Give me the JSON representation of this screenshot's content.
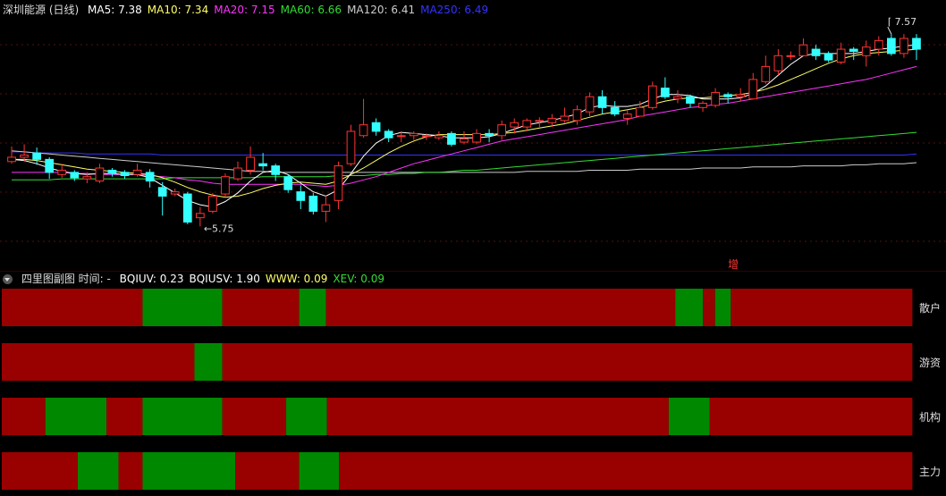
{
  "header": {
    "title": "深圳能源 (日线)",
    "ma_items": [
      {
        "label": "MA5: 7.38",
        "color": "#ffffff"
      },
      {
        "label": "MA10: 7.34",
        "color": "#ffff66"
      },
      {
        "label": "MA20: 7.15",
        "color": "#ff33ff"
      },
      {
        "label": "MA60: 6.66",
        "color": "#33dd33"
      },
      {
        "label": "MA120: 6.41",
        "color": "#cccccc"
      },
      {
        "label": "MA250: 6.49",
        "color": "#3333ff"
      }
    ]
  },
  "subheader": {
    "title": "四里图副图 时间: -",
    "items": [
      {
        "label": "BQIUV: 0.23",
        "color": "#ffffff"
      },
      {
        "label": "BQIUSV: 1.90",
        "color": "#ffffff"
      },
      {
        "label": "WWW: 0.09",
        "color": "#ffff66"
      },
      {
        "label": "XEV: 0.09",
        "color": "#33dd33"
      }
    ]
  },
  "colors": {
    "up": "#ff3333",
    "down": "#33ffff",
    "bar_red": "#990000",
    "bar_green": "#008800"
  },
  "chart_data": [
    {
      "type": "candlestick",
      "ylim": [
        5.5,
        7.75
      ],
      "annotations": {
        "high_label": "7.57",
        "low_label": "5.75",
        "marker": "增"
      },
      "candles": [
        [
          6.42,
          6.46,
          6.56,
          6.4
        ],
        [
          6.46,
          6.48,
          6.58,
          6.42
        ],
        [
          6.5,
          6.44,
          6.55,
          6.39
        ],
        [
          6.44,
          6.32,
          6.46,
          6.26
        ],
        [
          6.3,
          6.34,
          6.4,
          6.27
        ],
        [
          6.32,
          6.27,
          6.34,
          6.24
        ],
        [
          6.26,
          6.28,
          6.32,
          6.22
        ],
        [
          6.24,
          6.36,
          6.4,
          6.22
        ],
        [
          6.34,
          6.31,
          6.36,
          6.28
        ],
        [
          6.32,
          6.29,
          6.34,
          6.26
        ],
        [
          6.3,
          6.34,
          6.4,
          6.28
        ],
        [
          6.32,
          6.24,
          6.35,
          6.18
        ],
        [
          6.18,
          6.1,
          6.23,
          5.92
        ],
        [
          6.12,
          6.14,
          6.17,
          6.1
        ],
        [
          6.12,
          5.86,
          6.14,
          5.84
        ],
        [
          5.9,
          5.94,
          6.0,
          5.82
        ],
        [
          5.96,
          6.1,
          6.13,
          5.94
        ],
        [
          6.12,
          6.28,
          6.31,
          6.09
        ],
        [
          6.26,
          6.36,
          6.42,
          6.24
        ],
        [
          6.34,
          6.46,
          6.56,
          6.3
        ],
        [
          6.4,
          6.38,
          6.5,
          6.34
        ],
        [
          6.38,
          6.3,
          6.4,
          6.24
        ],
        [
          6.28,
          6.16,
          6.3,
          6.13
        ],
        [
          6.14,
          6.06,
          6.2,
          5.98
        ],
        [
          6.1,
          5.96,
          6.13,
          5.93
        ],
        [
          5.96,
          6.02,
          6.11,
          5.86
        ],
        [
          6.06,
          6.38,
          6.42,
          5.98
        ],
        [
          6.4,
          6.7,
          6.76,
          6.38
        ],
        [
          6.66,
          6.76,
          7.0,
          6.64
        ],
        [
          6.78,
          6.7,
          6.82,
          6.66
        ],
        [
          6.7,
          6.64,
          6.72,
          6.6
        ],
        [
          6.66,
          6.66,
          6.7,
          6.6
        ],
        [
          6.66,
          6.68,
          6.7,
          6.62
        ],
        [
          6.66,
          6.66,
          6.68,
          6.62
        ],
        [
          6.64,
          6.66,
          6.7,
          6.62
        ],
        [
          6.68,
          6.58,
          6.7,
          6.56
        ],
        [
          6.6,
          6.63,
          6.7,
          6.58
        ],
        [
          6.6,
          6.68,
          6.72,
          6.58
        ],
        [
          6.68,
          6.66,
          6.72,
          6.6
        ],
        [
          6.66,
          6.76,
          6.8,
          6.62
        ],
        [
          6.74,
          6.78,
          6.82,
          6.68
        ],
        [
          6.74,
          6.8,
          6.82,
          6.7
        ],
        [
          6.8,
          6.8,
          6.83,
          6.74
        ],
        [
          6.78,
          6.82,
          6.86,
          6.74
        ],
        [
          6.8,
          6.84,
          6.92,
          6.78
        ],
        [
          6.8,
          6.9,
          6.94,
          6.76
        ],
        [
          6.88,
          7.02,
          7.06,
          6.84
        ],
        [
          7.02,
          6.92,
          7.08,
          6.86
        ],
        [
          6.92,
          6.86,
          6.98,
          6.84
        ],
        [
          6.82,
          6.86,
          6.9,
          6.76
        ],
        [
          6.84,
          6.92,
          6.98,
          6.84
        ],
        [
          6.92,
          7.12,
          7.16,
          6.9
        ],
        [
          7.1,
          7.02,
          7.2,
          7.0
        ],
        [
          7.0,
          7.02,
          7.08,
          6.96
        ],
        [
          7.02,
          6.96,
          7.04,
          6.92
        ],
        [
          6.92,
          6.96,
          6.98,
          6.88
        ],
        [
          6.94,
          7.06,
          7.1,
          6.92
        ],
        [
          7.04,
          7.02,
          7.06,
          6.96
        ],
        [
          7.02,
          7.04,
          7.1,
          6.98
        ],
        [
          7.0,
          7.18,
          7.24,
          7.0
        ],
        [
          7.16,
          7.3,
          7.4,
          7.14
        ],
        [
          7.26,
          7.4,
          7.46,
          7.22
        ],
        [
          7.4,
          7.4,
          7.44,
          7.36
        ],
        [
          7.4,
          7.5,
          7.56,
          7.4
        ],
        [
          7.46,
          7.4,
          7.5,
          7.36
        ],
        [
          7.42,
          7.36,
          7.44,
          7.34
        ],
        [
          7.34,
          7.46,
          7.52,
          7.32
        ],
        [
          7.46,
          7.44,
          7.48,
          7.36
        ],
        [
          7.4,
          7.48,
          7.54,
          7.3
        ],
        [
          7.46,
          7.54,
          7.58,
          7.4
        ],
        [
          7.56,
          7.42,
          7.6,
          7.4
        ],
        [
          7.42,
          7.56,
          7.6,
          7.38
        ],
        [
          7.56,
          7.46,
          7.6,
          7.36
        ]
      ],
      "ma": {
        "MA5": [
          6.44,
          6.43,
          6.4,
          6.36,
          6.33,
          6.31,
          6.3,
          6.31,
          6.31,
          6.3,
          6.3,
          6.27,
          6.2,
          6.13,
          6.06,
          6.02,
          6.0,
          6.05,
          6.13,
          6.24,
          6.32,
          6.34,
          6.3,
          6.22,
          6.14,
          6.1,
          6.16,
          6.31,
          6.47,
          6.59,
          6.66,
          6.69,
          6.68,
          6.67,
          6.66,
          6.64,
          6.64,
          6.64,
          6.65,
          6.68,
          6.72,
          6.76,
          6.78,
          6.8,
          6.83,
          6.86,
          6.92,
          6.94,
          6.93,
          6.93,
          6.95,
          7.0,
          7.04,
          7.04,
          7.03,
          7.0,
          7.0,
          7.0,
          7.01,
          7.05,
          7.12,
          7.22,
          7.32,
          7.4,
          7.42,
          7.42,
          7.42,
          7.42,
          7.44,
          7.46,
          7.47,
          7.49,
          7.5
        ],
        "MA10": [
          6.44,
          6.44,
          6.43,
          6.41,
          6.39,
          6.37,
          6.35,
          6.34,
          6.33,
          6.32,
          6.31,
          6.3,
          6.27,
          6.23,
          6.18,
          6.14,
          6.11,
          6.09,
          6.1,
          6.13,
          6.17,
          6.2,
          6.22,
          6.23,
          6.22,
          6.21,
          6.24,
          6.3,
          6.36,
          6.43,
          6.5,
          6.56,
          6.61,
          6.65,
          6.67,
          6.67,
          6.67,
          6.67,
          6.67,
          6.68,
          6.69,
          6.71,
          6.73,
          6.75,
          6.77,
          6.8,
          6.83,
          6.86,
          6.88,
          6.9,
          6.92,
          6.95,
          6.98,
          7.0,
          7.01,
          7.01,
          7.02,
          7.03,
          7.04,
          7.06,
          7.09,
          7.13,
          7.18,
          7.23,
          7.28,
          7.33,
          7.37,
          7.4,
          7.42,
          7.43,
          7.44,
          7.45,
          7.46
        ],
        "MA20": [
          6.32,
          6.32,
          6.32,
          6.32,
          6.32,
          6.31,
          6.31,
          6.3,
          6.3,
          6.3,
          6.3,
          6.29,
          6.28,
          6.27,
          6.25,
          6.24,
          6.22,
          6.21,
          6.21,
          6.21,
          6.21,
          6.21,
          6.21,
          6.21,
          6.2,
          6.19,
          6.2,
          6.22,
          6.25,
          6.28,
          6.32,
          6.36,
          6.4,
          6.43,
          6.46,
          6.49,
          6.52,
          6.55,
          6.58,
          6.61,
          6.63,
          6.65,
          6.67,
          6.69,
          6.71,
          6.73,
          6.75,
          6.77,
          6.79,
          6.81,
          6.84,
          6.86,
          6.88,
          6.9,
          6.92,
          6.93,
          6.95,
          6.96,
          6.98,
          7.0,
          7.02,
          7.04,
          7.06,
          7.08,
          7.1,
          7.12,
          7.14,
          7.16,
          7.18,
          7.21,
          7.24,
          7.27,
          7.3
        ],
        "MA60": [
          6.25,
          6.25,
          6.25,
          6.25,
          6.26,
          6.26,
          6.26,
          6.26,
          6.26,
          6.26,
          6.26,
          6.26,
          6.26,
          6.27,
          6.27,
          6.27,
          6.27,
          6.27,
          6.27,
          6.27,
          6.28,
          6.28,
          6.28,
          6.28,
          6.28,
          6.28,
          6.29,
          6.29,
          6.29,
          6.3,
          6.3,
          6.31,
          6.31,
          6.32,
          6.32,
          6.33,
          6.34,
          6.34,
          6.35,
          6.36,
          6.37,
          6.38,
          6.39,
          6.4,
          6.41,
          6.42,
          6.43,
          6.44,
          6.45,
          6.46,
          6.47,
          6.48,
          6.49,
          6.5,
          6.51,
          6.52,
          6.53,
          6.54,
          6.55,
          6.56,
          6.57,
          6.58,
          6.59,
          6.6,
          6.61,
          6.62,
          6.63,
          6.64,
          6.65,
          6.66,
          6.67,
          6.68,
          6.69
        ],
        "MA120": [
          6.52,
          6.51,
          6.5,
          6.49,
          6.48,
          6.47,
          6.46,
          6.45,
          6.44,
          6.43,
          6.42,
          6.41,
          6.4,
          6.39,
          6.38,
          6.37,
          6.36,
          6.35,
          6.34,
          6.33,
          6.33,
          6.32,
          6.32,
          6.32,
          6.32,
          6.32,
          6.32,
          6.32,
          6.32,
          6.32,
          6.32,
          6.32,
          6.32,
          6.32,
          6.32,
          6.32,
          6.32,
          6.32,
          6.32,
          6.32,
          6.32,
          6.33,
          6.33,
          6.33,
          6.33,
          6.33,
          6.34,
          6.34,
          6.34,
          6.34,
          6.35,
          6.35,
          6.35,
          6.35,
          6.35,
          6.36,
          6.36,
          6.36,
          6.36,
          6.37,
          6.37,
          6.37,
          6.37,
          6.38,
          6.38,
          6.38,
          6.38,
          6.39,
          6.39,
          6.4,
          6.4,
          6.4,
          6.41
        ],
        "MA250": [
          6.51,
          6.51,
          6.5,
          6.5,
          6.5,
          6.5,
          6.49,
          6.49,
          6.49,
          6.49,
          6.49,
          6.49,
          6.48,
          6.48,
          6.48,
          6.48,
          6.48,
          6.48,
          6.48,
          6.48,
          6.48,
          6.48,
          6.48,
          6.48,
          6.48,
          6.48,
          6.48,
          6.48,
          6.48,
          6.48,
          6.48,
          6.48,
          6.48,
          6.48,
          6.48,
          6.48,
          6.48,
          6.48,
          6.48,
          6.48,
          6.48,
          6.48,
          6.48,
          6.48,
          6.48,
          6.48,
          6.48,
          6.48,
          6.48,
          6.48,
          6.48,
          6.48,
          6.48,
          6.48,
          6.48,
          6.48,
          6.48,
          6.48,
          6.48,
          6.48,
          6.48,
          6.48,
          6.48,
          6.48,
          6.48,
          6.48,
          6.48,
          6.48,
          6.48,
          6.48,
          6.48,
          6.48,
          6.49
        ]
      }
    },
    {
      "type": "heatmap",
      "note_units": "fraction of time axis",
      "rows": [
        {
          "label": "散户",
          "segments": [
            [
              0,
              0.152,
              "red"
            ],
            [
              0.152,
              0.238,
              "green"
            ],
            [
              0.238,
              0.321,
              "red"
            ],
            [
              0.321,
              0.35,
              "green"
            ],
            [
              0.35,
              0.727,
              "red"
            ],
            [
              0.727,
              0.757,
              "green"
            ],
            [
              0.757,
              0.77,
              "red"
            ],
            [
              0.77,
              0.787,
              "green"
            ],
            [
              0.787,
              0.983,
              "red"
            ]
          ]
        },
        {
          "label": "游资",
          "segments": [
            [
              0,
              0.208,
              "red"
            ],
            [
              0.208,
              0.238,
              "green"
            ],
            [
              0.238,
              0.983,
              "red"
            ]
          ]
        },
        {
          "label": "机构",
          "segments": [
            [
              0,
              0.047,
              "red"
            ],
            [
              0.047,
              0.113,
              "green"
            ],
            [
              0.113,
              0.152,
              "red"
            ],
            [
              0.152,
              0.238,
              "green"
            ],
            [
              0.238,
              0.307,
              "red"
            ],
            [
              0.307,
              0.351,
              "green"
            ],
            [
              0.351,
              0.72,
              "red"
            ],
            [
              0.72,
              0.764,
              "green"
            ],
            [
              0.764,
              0.983,
              "red"
            ]
          ]
        },
        {
          "label": "主力",
          "segments": [
            [
              0,
              0.082,
              "red"
            ],
            [
              0.082,
              0.126,
              "green"
            ],
            [
              0.126,
              0.152,
              "red"
            ],
            [
              0.152,
              0.252,
              "green"
            ],
            [
              0.252,
              0.321,
              "red"
            ],
            [
              0.321,
              0.364,
              "green"
            ],
            [
              0.364,
              0.983,
              "red"
            ]
          ]
        }
      ]
    }
  ]
}
